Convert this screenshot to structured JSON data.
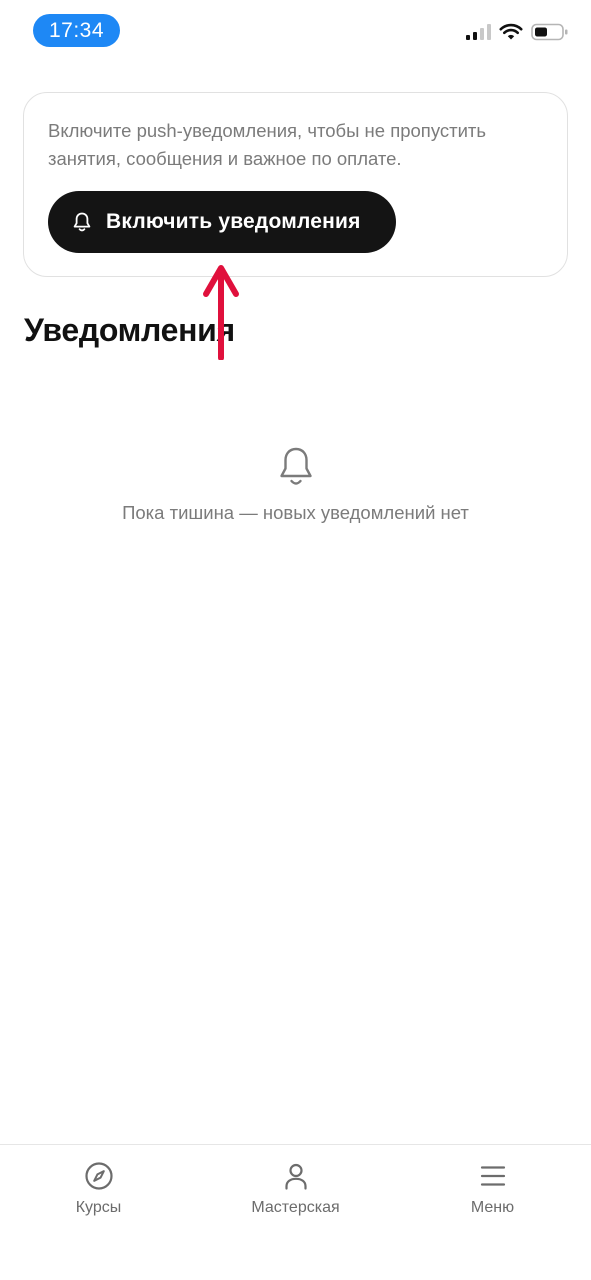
{
  "status_bar": {
    "time": "17:34"
  },
  "push_banner": {
    "text": "Включите push-уведомления, чтобы не пропустить занятия, сообщения и важное по оплате.",
    "button_label": "Включить уведомления",
    "button_icon": "bell-icon"
  },
  "page": {
    "title": "Уведомления"
  },
  "empty_state": {
    "icon": "bell-icon",
    "text": "Пока тишина — новых уведомлений нет"
  },
  "bottom_nav": {
    "items": [
      {
        "label": "Курсы",
        "icon": "compass-icon"
      },
      {
        "label": "Мастерская",
        "icon": "person-icon"
      },
      {
        "label": "Меню",
        "icon": "hamburger-menu-icon"
      }
    ]
  },
  "colors": {
    "time_pill": "#1e88f5",
    "button_bg": "#141414",
    "annotation_arrow": "#e0103c",
    "secondary_text": "#7b7b7b"
  }
}
